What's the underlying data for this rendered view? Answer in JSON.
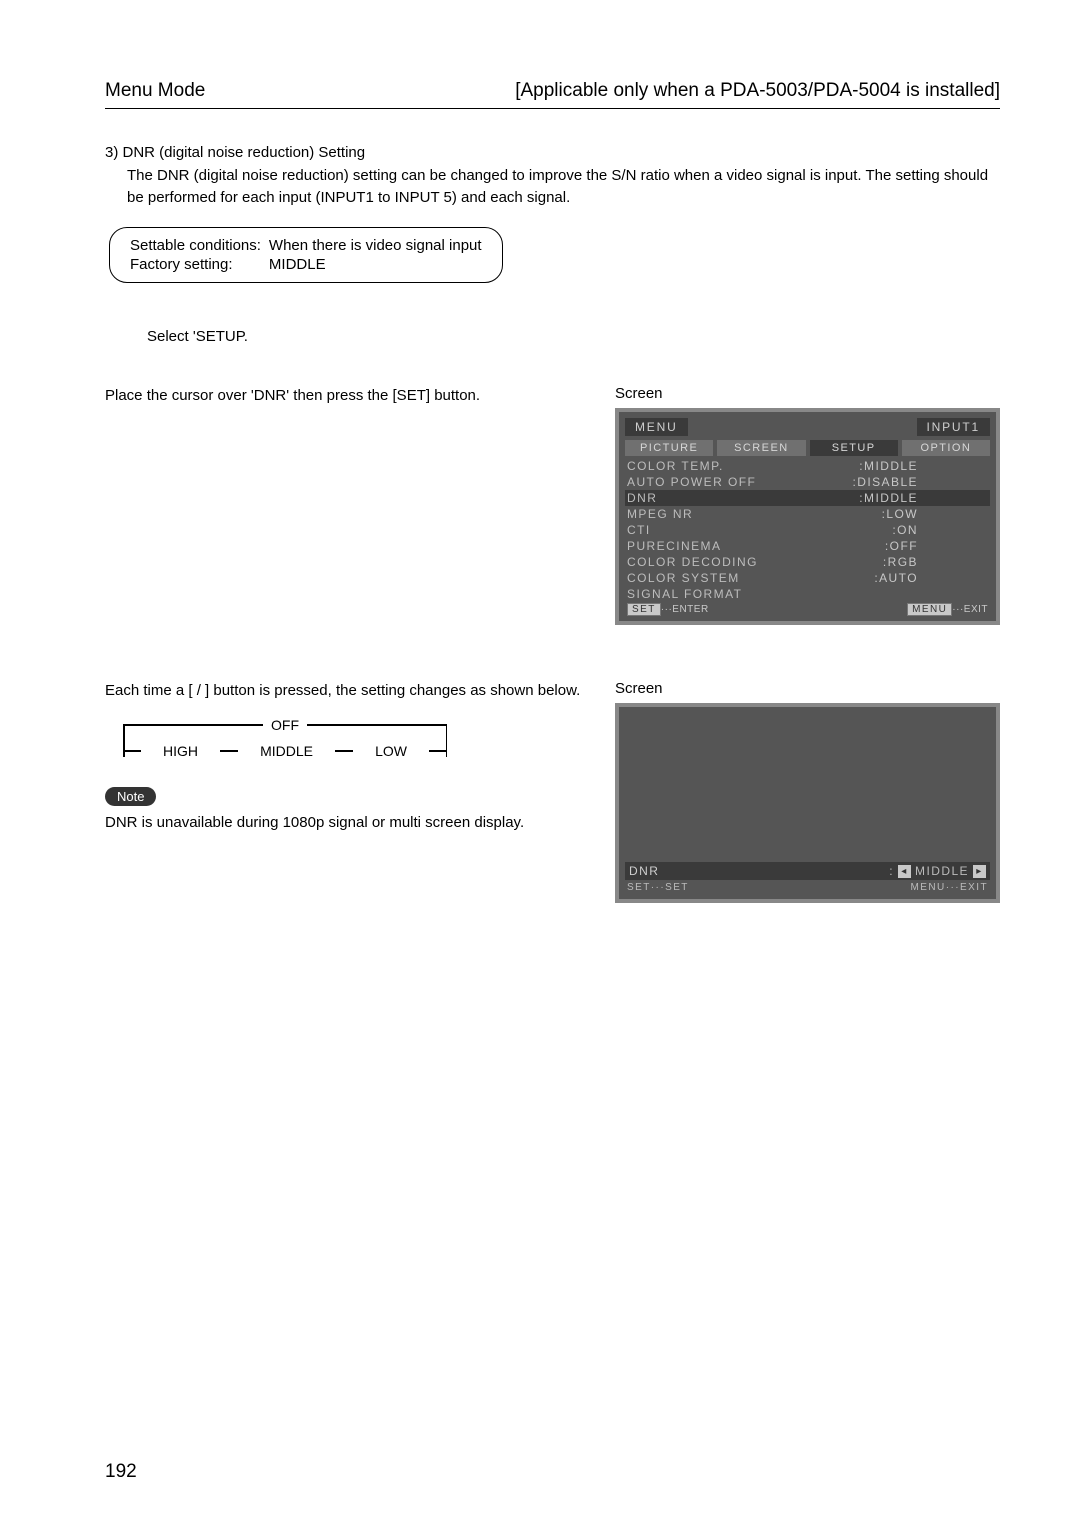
{
  "header": {
    "left": "Menu Mode",
    "right": "[Applicable only when a PDA-5003/PDA-5004 is installed]"
  },
  "section": {
    "title": "3) DNR (digital noise reduction) Setting",
    "desc": "The DNR (digital noise reduction) setting can be changed to improve the S/N ratio when a video signal is input. The setting should be performed for each input (INPUT1 to INPUT 5) and each signal."
  },
  "settings_box": {
    "row1_label": "Settable conditions:",
    "row1_value": "When there is video signal input",
    "row2_label": "Factory setting:",
    "row2_value": "MIDDLE"
  },
  "step1": "Select 'SETUP.",
  "step2": {
    "text": "Place the cursor over 'DNR' then press the [SET] button.",
    "screen_label": "Screen"
  },
  "osd1": {
    "menu_badge": "MENU",
    "input_badge": "INPUT1",
    "tabs": [
      "PICTURE",
      "SCREEN",
      "SETUP",
      "OPTION"
    ],
    "active_tab_index": 2,
    "rows": [
      {
        "label": "COLOR TEMP.",
        "value": ":MIDDLE",
        "hl": false
      },
      {
        "label": "AUTO POWER OFF",
        "value": ":DISABLE",
        "hl": false
      },
      {
        "label": "DNR",
        "value": ":MIDDLE",
        "hl": true
      },
      {
        "label": "MPEG NR",
        "value": ":LOW",
        "hl": false
      },
      {
        "label": "CTI",
        "value": ":ON",
        "hl": false
      },
      {
        "label": "PURECINEMA",
        "value": ":OFF",
        "hl": false
      },
      {
        "label": "COLOR DECODING",
        "value": ":RGB",
        "hl": false
      },
      {
        "label": "COLOR SYSTEM",
        "value": ":AUTO",
        "hl": false
      },
      {
        "label": "SIGNAL FORMAT",
        "value": "",
        "hl": false
      }
    ],
    "help_left_badge": "SET",
    "help_left_text": "···ENTER",
    "help_right_badge": "MENU",
    "help_right_text": "···EXIT"
  },
  "step3": {
    "text": "Each time a [   /   ] button is pressed, the setting changes as shown below.",
    "screen_label": "Screen",
    "cycle": {
      "top": "OFF",
      "left": "HIGH",
      "mid": "MIDDLE",
      "right": "LOW"
    }
  },
  "osd2": {
    "label": "DNR",
    "colon": ":",
    "value": "MIDDLE",
    "arrow_left": "◂",
    "arrow_right": "▸",
    "help_left_badge": "SET",
    "help_left_text": "···SET",
    "help_right_badge": "MENU",
    "help_right_text": "···EXIT"
  },
  "note": {
    "pill": "Note",
    "text": "DNR is unavailable during 1080p signal or multi screen display."
  },
  "page_number": "192"
}
